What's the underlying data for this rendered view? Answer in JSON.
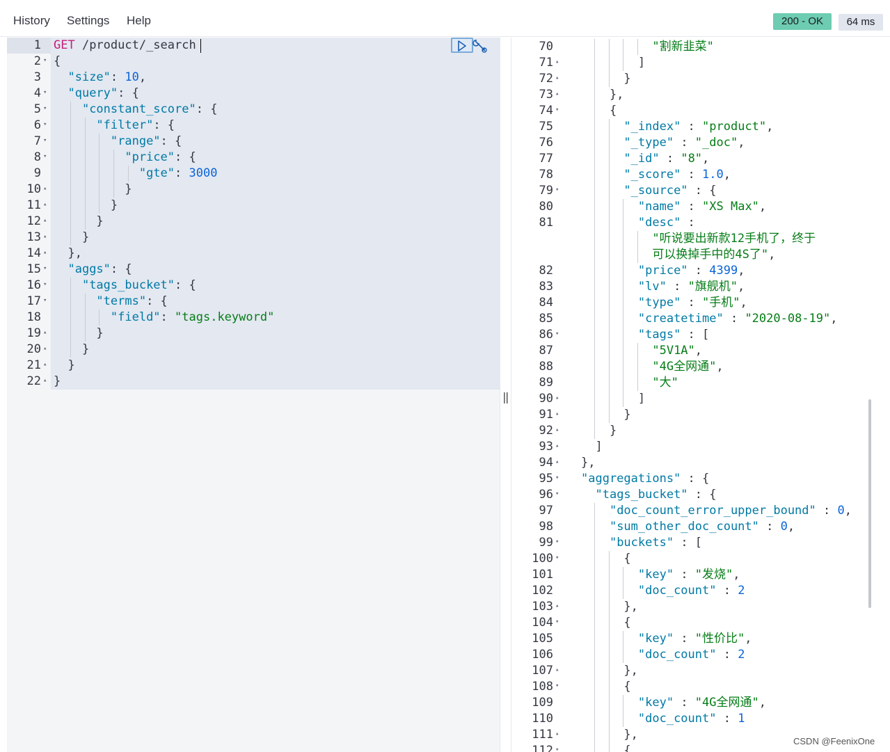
{
  "menu": {
    "history": "History",
    "settings": "Settings",
    "help": "Help"
  },
  "status": {
    "code": "200 - OK",
    "time": "64 ms",
    "colors": {
      "ok": "#6dccb1",
      "time": "#e0e5ee"
    }
  },
  "editor": {
    "request_method": "GET",
    "request_path": "/product/_search",
    "lines": [
      {
        "n": "1",
        "fold": "",
        "code": [
          [
            "m",
            "GET"
          ],
          [
            "p",
            " /product/_search"
          ]
        ]
      },
      {
        "n": "2",
        "fold": "▾",
        "code": [
          [
            "p",
            "{"
          ]
        ]
      },
      {
        "n": "3",
        "fold": "",
        "code": [
          [
            "p",
            "  "
          ],
          [
            "k",
            "\"size\""
          ],
          [
            "p",
            ": "
          ],
          [
            "n",
            "10"
          ],
          [
            "p",
            ","
          ]
        ]
      },
      {
        "n": "4",
        "fold": "▾",
        "code": [
          [
            "p",
            "  "
          ],
          [
            "k",
            "\"query\""
          ],
          [
            "p",
            ": {"
          ]
        ]
      },
      {
        "n": "5",
        "fold": "▾",
        "code": [
          [
            "p",
            "    "
          ],
          [
            "k",
            "\"constant_score\""
          ],
          [
            "p",
            ": {"
          ]
        ]
      },
      {
        "n": "6",
        "fold": "▾",
        "code": [
          [
            "p",
            "      "
          ],
          [
            "k",
            "\"filter\""
          ],
          [
            "p",
            ": {"
          ]
        ]
      },
      {
        "n": "7",
        "fold": "▾",
        "code": [
          [
            "p",
            "        "
          ],
          [
            "k",
            "\"range\""
          ],
          [
            "p",
            ": {"
          ]
        ]
      },
      {
        "n": "8",
        "fold": "▾",
        "code": [
          [
            "p",
            "          "
          ],
          [
            "k",
            "\"price\""
          ],
          [
            "p",
            ": {"
          ]
        ]
      },
      {
        "n": "9",
        "fold": "",
        "code": [
          [
            "p",
            "            "
          ],
          [
            "k",
            "\"gte\""
          ],
          [
            "p",
            ": "
          ],
          [
            "n",
            "3000"
          ]
        ]
      },
      {
        "n": "10",
        "fold": "▴",
        "code": [
          [
            "p",
            "          }"
          ]
        ]
      },
      {
        "n": "11",
        "fold": "▴",
        "code": [
          [
            "p",
            "        }"
          ]
        ]
      },
      {
        "n": "12",
        "fold": "▴",
        "code": [
          [
            "p",
            "      }"
          ]
        ]
      },
      {
        "n": "13",
        "fold": "▴",
        "code": [
          [
            "p",
            "    }"
          ]
        ]
      },
      {
        "n": "14",
        "fold": "▴",
        "code": [
          [
            "p",
            "  },"
          ]
        ]
      },
      {
        "n": "15",
        "fold": "▾",
        "code": [
          [
            "p",
            "  "
          ],
          [
            "k",
            "\"aggs\""
          ],
          [
            "p",
            ": {"
          ]
        ]
      },
      {
        "n": "16",
        "fold": "▾",
        "code": [
          [
            "p",
            "    "
          ],
          [
            "k",
            "\"tags_bucket\""
          ],
          [
            "p",
            ": {"
          ]
        ]
      },
      {
        "n": "17",
        "fold": "▾",
        "code": [
          [
            "p",
            "      "
          ],
          [
            "k",
            "\"terms\""
          ],
          [
            "p",
            ": {"
          ]
        ]
      },
      {
        "n": "18",
        "fold": "",
        "code": [
          [
            "p",
            "        "
          ],
          [
            "k",
            "\"field\""
          ],
          [
            "p",
            ": "
          ],
          [
            "s",
            "\"tags.keyword\""
          ]
        ]
      },
      {
        "n": "19",
        "fold": "▴",
        "code": [
          [
            "p",
            "      }"
          ]
        ]
      },
      {
        "n": "20",
        "fold": "▴",
        "code": [
          [
            "p",
            "    }"
          ]
        ]
      },
      {
        "n": "21",
        "fold": "▴",
        "code": [
          [
            "p",
            "  }"
          ]
        ]
      },
      {
        "n": "22",
        "fold": "▴",
        "code": [
          [
            "p",
            "}"
          ]
        ]
      }
    ]
  },
  "response": {
    "lines": [
      {
        "n": "70",
        "fold": "",
        "code": [
          [
            "p",
            "          "
          ],
          [
            "s",
            "\"割新韭菜\""
          ]
        ]
      },
      {
        "n": "71",
        "fold": "▴",
        "code": [
          [
            "p",
            "        ]"
          ]
        ]
      },
      {
        "n": "72",
        "fold": "▴",
        "code": [
          [
            "p",
            "      }"
          ]
        ]
      },
      {
        "n": "73",
        "fold": "▴",
        "code": [
          [
            "p",
            "    },"
          ]
        ]
      },
      {
        "n": "74",
        "fold": "▾",
        "code": [
          [
            "p",
            "    {"
          ]
        ]
      },
      {
        "n": "75",
        "fold": "",
        "code": [
          [
            "p",
            "      "
          ],
          [
            "k",
            "\"_index\""
          ],
          [
            "p",
            " : "
          ],
          [
            "s",
            "\"product\""
          ],
          [
            "p",
            ","
          ]
        ]
      },
      {
        "n": "76",
        "fold": "",
        "code": [
          [
            "p",
            "      "
          ],
          [
            "k",
            "\"_type\""
          ],
          [
            "p",
            " : "
          ],
          [
            "s",
            "\"_doc\""
          ],
          [
            "p",
            ","
          ]
        ]
      },
      {
        "n": "77",
        "fold": "",
        "code": [
          [
            "p",
            "      "
          ],
          [
            "k",
            "\"_id\""
          ],
          [
            "p",
            " : "
          ],
          [
            "s",
            "\"8\""
          ],
          [
            "p",
            ","
          ]
        ]
      },
      {
        "n": "78",
        "fold": "",
        "code": [
          [
            "p",
            "      "
          ],
          [
            "k",
            "\"_score\""
          ],
          [
            "p",
            " : "
          ],
          [
            "n",
            "1.0"
          ],
          [
            "p",
            ","
          ]
        ]
      },
      {
        "n": "79",
        "fold": "▾",
        "code": [
          [
            "p",
            "      "
          ],
          [
            "k",
            "\"_source\""
          ],
          [
            "p",
            " : {"
          ]
        ]
      },
      {
        "n": "80",
        "fold": "",
        "code": [
          [
            "p",
            "        "
          ],
          [
            "k",
            "\"name\""
          ],
          [
            "p",
            " : "
          ],
          [
            "s",
            "\"XS Max\""
          ],
          [
            "p",
            ","
          ]
        ]
      },
      {
        "n": "81",
        "fold": "",
        "code": [
          [
            "p",
            "        "
          ],
          [
            "k",
            "\"desc\""
          ],
          [
            "p",
            " :"
          ]
        ]
      },
      {
        "n": "",
        "fold": "",
        "code": [
          [
            "p",
            "          "
          ],
          [
            "s",
            "\"听说要出新款12手机了，终于"
          ]
        ]
      },
      {
        "n": "",
        "fold": "",
        "code": [
          [
            "p",
            "          "
          ],
          [
            "s",
            "可以换掉手中的4S了\""
          ],
          [
            "p",
            ","
          ]
        ]
      },
      {
        "n": "82",
        "fold": "",
        "code": [
          [
            "p",
            "        "
          ],
          [
            "k",
            "\"price\""
          ],
          [
            "p",
            " : "
          ],
          [
            "n",
            "4399"
          ],
          [
            "p",
            ","
          ]
        ]
      },
      {
        "n": "83",
        "fold": "",
        "code": [
          [
            "p",
            "        "
          ],
          [
            "k",
            "\"lv\""
          ],
          [
            "p",
            " : "
          ],
          [
            "s",
            "\"旗舰机\""
          ],
          [
            "p",
            ","
          ]
        ]
      },
      {
        "n": "84",
        "fold": "",
        "code": [
          [
            "p",
            "        "
          ],
          [
            "k",
            "\"type\""
          ],
          [
            "p",
            " : "
          ],
          [
            "s",
            "\"手机\""
          ],
          [
            "p",
            ","
          ]
        ]
      },
      {
        "n": "85",
        "fold": "",
        "code": [
          [
            "p",
            "        "
          ],
          [
            "k",
            "\"createtime\""
          ],
          [
            "p",
            " : "
          ],
          [
            "s",
            "\"2020-08-19\""
          ],
          [
            "p",
            ","
          ]
        ]
      },
      {
        "n": "86",
        "fold": "▾",
        "code": [
          [
            "p",
            "        "
          ],
          [
            "k",
            "\"tags\""
          ],
          [
            "p",
            " : ["
          ]
        ]
      },
      {
        "n": "87",
        "fold": "",
        "code": [
          [
            "p",
            "          "
          ],
          [
            "s",
            "\"5V1A\""
          ],
          [
            "p",
            ","
          ]
        ]
      },
      {
        "n": "88",
        "fold": "",
        "code": [
          [
            "p",
            "          "
          ],
          [
            "s",
            "\"4G全网通\""
          ],
          [
            "p",
            ","
          ]
        ]
      },
      {
        "n": "89",
        "fold": "",
        "code": [
          [
            "p",
            "          "
          ],
          [
            "s",
            "\"大\""
          ]
        ]
      },
      {
        "n": "90",
        "fold": "▴",
        "code": [
          [
            "p",
            "        ]"
          ]
        ]
      },
      {
        "n": "91",
        "fold": "▴",
        "code": [
          [
            "p",
            "      }"
          ]
        ]
      },
      {
        "n": "92",
        "fold": "▴",
        "code": [
          [
            "p",
            "    }"
          ]
        ]
      },
      {
        "n": "93",
        "fold": "▴",
        "code": [
          [
            "p",
            "  ]"
          ]
        ]
      },
      {
        "n": "94",
        "fold": "▴",
        "code": [
          [
            "p",
            "},"
          ]
        ]
      },
      {
        "n": "95",
        "fold": "▾",
        "code": [
          [
            "k",
            "\"aggregations\""
          ],
          [
            "p",
            " : {"
          ]
        ]
      },
      {
        "n": "96",
        "fold": "▾",
        "code": [
          [
            "p",
            "  "
          ],
          [
            "k",
            "\"tags_bucket\""
          ],
          [
            "p",
            " : {"
          ]
        ]
      },
      {
        "n": "97",
        "fold": "",
        "code": [
          [
            "p",
            "    "
          ],
          [
            "k",
            "\"doc_count_error_upper_bound\""
          ],
          [
            "p",
            " : "
          ],
          [
            "n",
            "0"
          ],
          [
            "p",
            ","
          ]
        ]
      },
      {
        "n": "98",
        "fold": "",
        "code": [
          [
            "p",
            "    "
          ],
          [
            "k",
            "\"sum_other_doc_count\""
          ],
          [
            "p",
            " : "
          ],
          [
            "n",
            "0"
          ],
          [
            "p",
            ","
          ]
        ]
      },
      {
        "n": "99",
        "fold": "▾",
        "code": [
          [
            "p",
            "    "
          ],
          [
            "k",
            "\"buckets\""
          ],
          [
            "p",
            " : ["
          ]
        ]
      },
      {
        "n": "100",
        "fold": "▾",
        "code": [
          [
            "p",
            "      {"
          ]
        ]
      },
      {
        "n": "101",
        "fold": "",
        "code": [
          [
            "p",
            "        "
          ],
          [
            "k",
            "\"key\""
          ],
          [
            "p",
            " : "
          ],
          [
            "s",
            "\"发烧\""
          ],
          [
            "p",
            ","
          ]
        ]
      },
      {
        "n": "102",
        "fold": "",
        "code": [
          [
            "p",
            "        "
          ],
          [
            "k",
            "\"doc_count\""
          ],
          [
            "p",
            " : "
          ],
          [
            "n",
            "2"
          ]
        ]
      },
      {
        "n": "103",
        "fold": "▴",
        "code": [
          [
            "p",
            "      },"
          ]
        ]
      },
      {
        "n": "104",
        "fold": "▾",
        "code": [
          [
            "p",
            "      {"
          ]
        ]
      },
      {
        "n": "105",
        "fold": "",
        "code": [
          [
            "p",
            "        "
          ],
          [
            "k",
            "\"key\""
          ],
          [
            "p",
            " : "
          ],
          [
            "s",
            "\"性价比\""
          ],
          [
            "p",
            ","
          ]
        ]
      },
      {
        "n": "106",
        "fold": "",
        "code": [
          [
            "p",
            "        "
          ],
          [
            "k",
            "\"doc_count\""
          ],
          [
            "p",
            " : "
          ],
          [
            "n",
            "2"
          ]
        ]
      },
      {
        "n": "107",
        "fold": "▴",
        "code": [
          [
            "p",
            "      },"
          ]
        ]
      },
      {
        "n": "108",
        "fold": "▾",
        "code": [
          [
            "p",
            "      {"
          ]
        ]
      },
      {
        "n": "109",
        "fold": "",
        "code": [
          [
            "p",
            "        "
          ],
          [
            "k",
            "\"key\""
          ],
          [
            "p",
            " : "
          ],
          [
            "s",
            "\"4G全网通\""
          ],
          [
            "p",
            ","
          ]
        ]
      },
      {
        "n": "110",
        "fold": "",
        "code": [
          [
            "p",
            "        "
          ],
          [
            "k",
            "\"doc_count\""
          ],
          [
            "p",
            " : "
          ],
          [
            "n",
            "1"
          ]
        ]
      },
      {
        "n": "111",
        "fold": "▴",
        "code": [
          [
            "p",
            "      },"
          ]
        ]
      },
      {
        "n": "112",
        "fold": "▾",
        "code": [
          [
            "p",
            "      {"
          ]
        ]
      }
    ]
  },
  "watermark": "CSDN @FeenixOne",
  "icons": {
    "run": "play-icon",
    "settings": "wrench-icon"
  }
}
